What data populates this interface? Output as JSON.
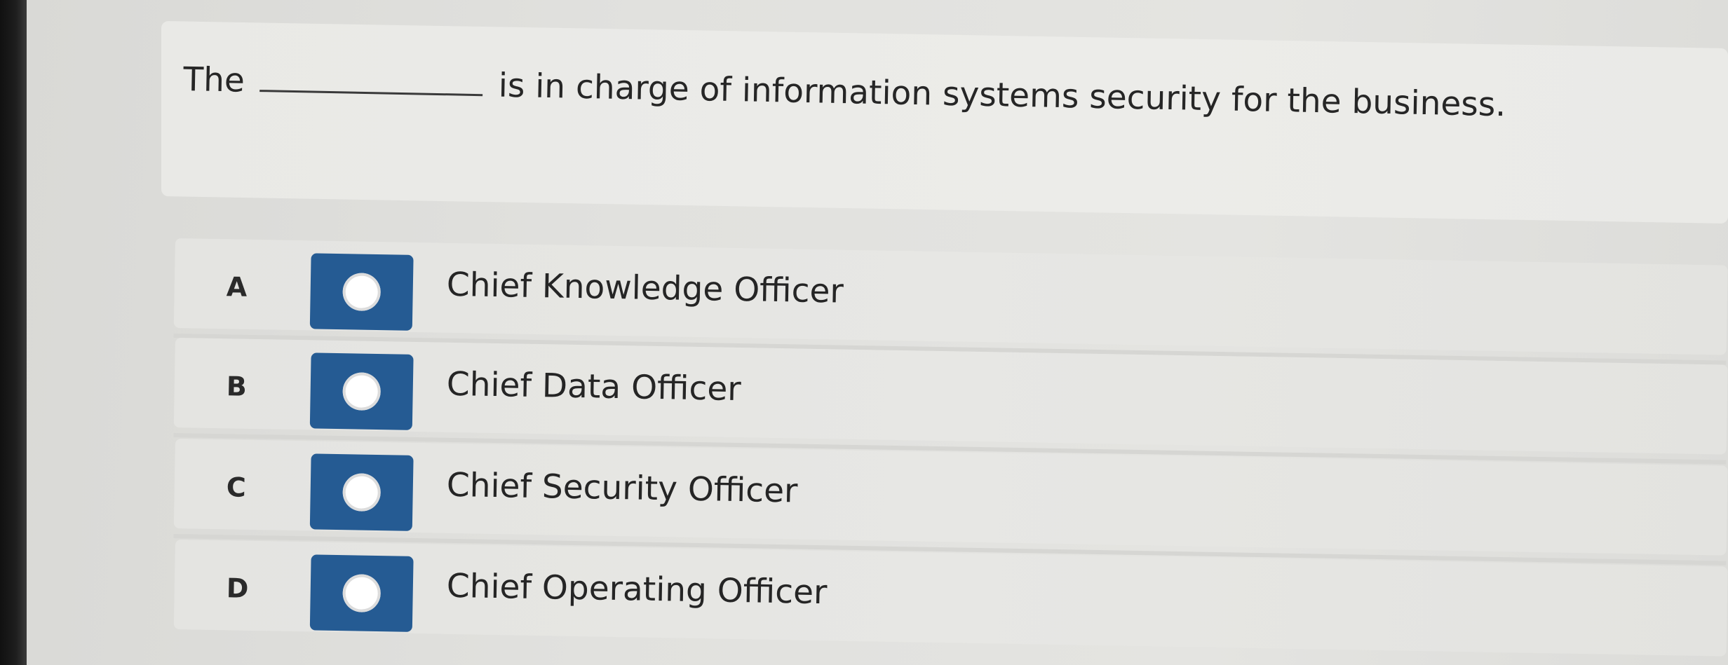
{
  "question": {
    "before": "The",
    "after": "is in charge of information systems security for the business."
  },
  "options": [
    {
      "letter": "A",
      "label": "Chief Knowledge Officer"
    },
    {
      "letter": "B",
      "label": "Chief Data Officer"
    },
    {
      "letter": "C",
      "label": "Chief Security Officer"
    },
    {
      "letter": "D",
      "label": "Chief Operating Officer"
    }
  ],
  "colors": {
    "radio_box": "#255b93",
    "radio_circle": "#ffffff",
    "background": "#e4e4e1"
  }
}
